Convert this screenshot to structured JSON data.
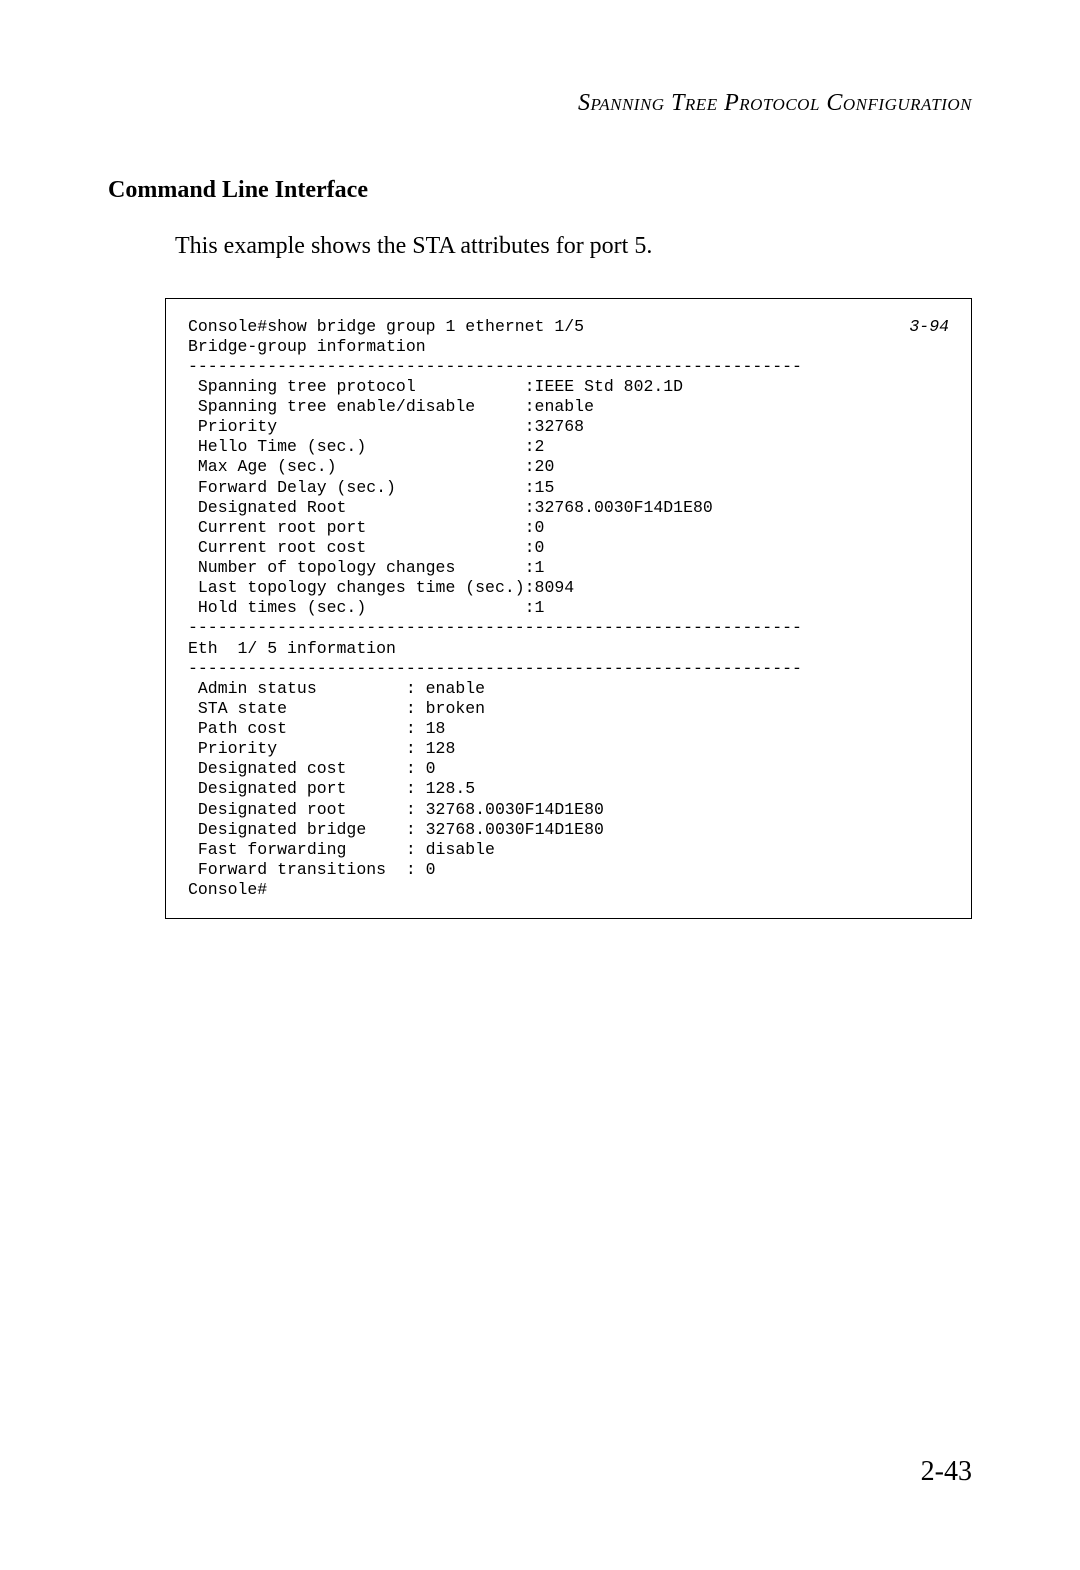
{
  "header": {
    "title": "Spanning Tree Protocol Configuration"
  },
  "section": {
    "heading": "Command Line Interface",
    "body": "This example shows the STA attributes for port 5."
  },
  "console": {
    "ref": "3-94",
    "command_line": "Console#show bridge group 1 ethernet 1/5",
    "bridge_group_header": "Bridge-group information",
    "divider": "--------------------------------------------------------------",
    "bridge_group": [
      {
        "label": " Spanning tree protocol           ",
        "value": ":IEEE Std 802.1D"
      },
      {
        "label": " Spanning tree enable/disable     ",
        "value": ":enable"
      },
      {
        "label": " Priority                         ",
        "value": ":32768"
      },
      {
        "label": " Hello Time (sec.)                ",
        "value": ":2"
      },
      {
        "label": " Max Age (sec.)                   ",
        "value": ":20"
      },
      {
        "label": " Forward Delay (sec.)             ",
        "value": ":15"
      },
      {
        "label": " Designated Root                  ",
        "value": ":32768.0030F14D1E80"
      },
      {
        "label": " Current root port                ",
        "value": ":0"
      },
      {
        "label": " Current root cost                ",
        "value": ":0"
      },
      {
        "label": " Number of topology changes       ",
        "value": ":1"
      },
      {
        "label": " Last topology changes time (sec.)",
        "value": ":8094"
      },
      {
        "label": " Hold times (sec.)                ",
        "value": ":1"
      }
    ],
    "eth_header": "Eth  1/ 5 information",
    "eth_info": [
      {
        "label": " Admin status         ",
        "value": ": enable"
      },
      {
        "label": " STA state            ",
        "value": ": broken"
      },
      {
        "label": " Path cost            ",
        "value": ": 18"
      },
      {
        "label": " Priority             ",
        "value": ": 128"
      },
      {
        "label": " Designated cost      ",
        "value": ": 0"
      },
      {
        "label": " Designated port      ",
        "value": ": 128.5"
      },
      {
        "label": " Designated root      ",
        "value": ": 32768.0030F14D1E80"
      },
      {
        "label": " Designated bridge    ",
        "value": ": 32768.0030F14D1E80"
      },
      {
        "label": " Fast forwarding      ",
        "value": ": disable"
      },
      {
        "label": " Forward transitions  ",
        "value": ": 0"
      }
    ],
    "prompt": "Console#"
  },
  "page_number": "2-43"
}
